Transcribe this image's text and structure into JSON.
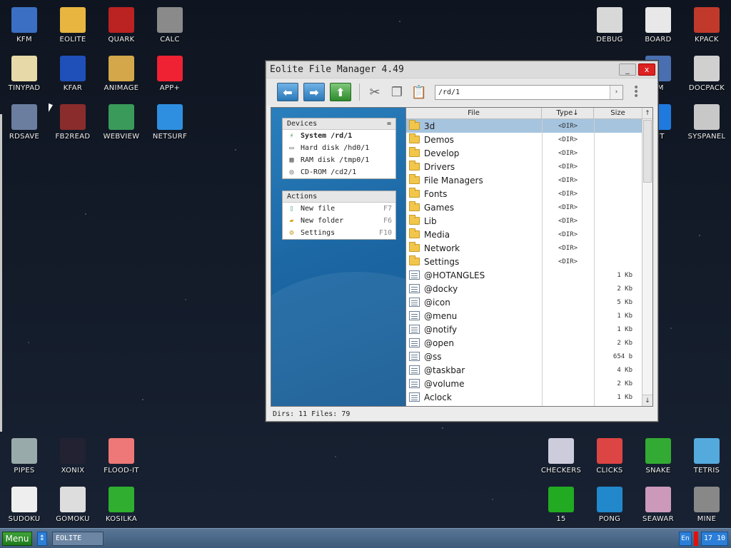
{
  "desktop": {
    "icons_left_top": [
      {
        "label": "KFM",
        "icon": "floppy-icon"
      },
      {
        "label": "EOLITE",
        "icon": "folder-icon"
      },
      {
        "label": "QUARK",
        "icon": "notebook-icon"
      },
      {
        "label": "CALC",
        "icon": "calculator-icon"
      },
      {
        "label": "TINYPAD",
        "icon": "notepad-icon"
      },
      {
        "label": "KFAR",
        "icon": "kfar-icon"
      },
      {
        "label": "ANIMAGE",
        "icon": "paint-icon"
      },
      {
        "label": "APP+",
        "icon": "cube-icon"
      },
      {
        "label": "RDSAVE",
        "icon": "save-icon"
      },
      {
        "label": "FB2READ",
        "icon": "book-icon"
      },
      {
        "label": "WEBVIEW",
        "icon": "web-icon"
      },
      {
        "label": "NETSURF",
        "icon": "globe-icon"
      }
    ],
    "icons_right_top": [
      {
        "label": "DEBUG",
        "icon": "bug-icon"
      },
      {
        "label": "BOARD",
        "icon": "board-icon"
      },
      {
        "label": "KPACK",
        "icon": "hammer-icon"
      },
      {
        "label": "SM",
        "icon": "sm-icon"
      },
      {
        "label": "DOCPACK",
        "icon": "cabinet-icon"
      },
      {
        "label": "DIT",
        "icon": "edit-icon"
      },
      {
        "label": "SYSPANEL",
        "icon": "sliders-icon"
      }
    ],
    "icons_left_bottom": [
      {
        "label": "PIPES",
        "icon": "pipes-icon"
      },
      {
        "label": "XONIX",
        "icon": "xonix-icon"
      },
      {
        "label": "FLOOD-IT",
        "icon": "flood-icon"
      },
      {
        "label": "SUDOKU",
        "icon": "sudoku-icon"
      },
      {
        "label": "GOMOKU",
        "icon": "gomoku-icon"
      },
      {
        "label": "KOSILKA",
        "icon": "mower-icon"
      }
    ],
    "icons_right_bottom": [
      {
        "label": "CHECKERS",
        "icon": "checkers-icon"
      },
      {
        "label": "CLICKS",
        "icon": "clicks-icon"
      },
      {
        "label": "SNAKE",
        "icon": "snake-icon"
      },
      {
        "label": "TETRIS",
        "icon": "tetris-icon"
      },
      {
        "label": "15",
        "icon": "fifteen-icon"
      },
      {
        "label": "PONG",
        "icon": "pong-icon"
      },
      {
        "label": "SEAWAR",
        "icon": "seawar-icon"
      },
      {
        "label": "MINE",
        "icon": "mine-icon"
      }
    ]
  },
  "window": {
    "title": "Eolite File Manager 4.49",
    "minimize_label": "_",
    "close_label": "x",
    "path": "/rd/1",
    "go_label": "›",
    "devices": {
      "header": "Devices",
      "toggle": "=",
      "items": [
        {
          "label": "System /rd/1"
        },
        {
          "label": "Hard disk /hd0/1"
        },
        {
          "label": "RAM disk /tmp0/1"
        },
        {
          "label": "CD-ROM /cd2/1"
        }
      ]
    },
    "actions": {
      "header": "Actions",
      "items": [
        {
          "label": "New file",
          "key": "F7"
        },
        {
          "label": "New folder",
          "key": "F6"
        },
        {
          "label": "Settings",
          "key": "F10"
        }
      ]
    },
    "columns": {
      "file": "File",
      "type": "Type↓",
      "size": "Size"
    },
    "files": [
      {
        "name": "3d",
        "type": "<DIR>",
        "size": "",
        "kind": "dir"
      },
      {
        "name": "Demos",
        "type": "<DIR>",
        "size": "",
        "kind": "dir"
      },
      {
        "name": "Develop",
        "type": "<DIR>",
        "size": "",
        "kind": "dir"
      },
      {
        "name": "Drivers",
        "type": "<DIR>",
        "size": "",
        "kind": "dir"
      },
      {
        "name": "File Managers",
        "type": "<DIR>",
        "size": "",
        "kind": "dir"
      },
      {
        "name": "Fonts",
        "type": "<DIR>",
        "size": "",
        "kind": "dir"
      },
      {
        "name": "Games",
        "type": "<DIR>",
        "size": "",
        "kind": "dir"
      },
      {
        "name": "Lib",
        "type": "<DIR>",
        "size": "",
        "kind": "dir"
      },
      {
        "name": "Media",
        "type": "<DIR>",
        "size": "",
        "kind": "dir"
      },
      {
        "name": "Network",
        "type": "<DIR>",
        "size": "",
        "kind": "dir"
      },
      {
        "name": "Settings",
        "type": "<DIR>",
        "size": "",
        "kind": "dir"
      },
      {
        "name": "@HOTANGLES",
        "type": "",
        "size": "1 Kb",
        "kind": "file"
      },
      {
        "name": "@docky",
        "type": "",
        "size": "2 Kb",
        "kind": "file"
      },
      {
        "name": "@icon",
        "type": "",
        "size": "5 Kb",
        "kind": "file"
      },
      {
        "name": "@menu",
        "type": "",
        "size": "1 Kb",
        "kind": "file"
      },
      {
        "name": "@notify",
        "type": "",
        "size": "1 Kb",
        "kind": "file"
      },
      {
        "name": "@open",
        "type": "",
        "size": "2 Kb",
        "kind": "file"
      },
      {
        "name": "@ss",
        "type": "",
        "size": "654 b",
        "kind": "file"
      },
      {
        "name": "@taskbar",
        "type": "",
        "size": "4 Kb",
        "kind": "file"
      },
      {
        "name": "@volume",
        "type": "",
        "size": "2 Kb",
        "kind": "file"
      },
      {
        "name": "Aclock",
        "type": "",
        "size": "1 Kb",
        "kind": "file"
      }
    ],
    "scroll_up": "↑",
    "scroll_down": "↓",
    "status": "Dirs: 11  Files: 79"
  },
  "taskbar": {
    "menu_label": "Menu",
    "switch_label": "↕",
    "task_label": "EOLITE",
    "lang": "En",
    "clock": "17 10"
  }
}
